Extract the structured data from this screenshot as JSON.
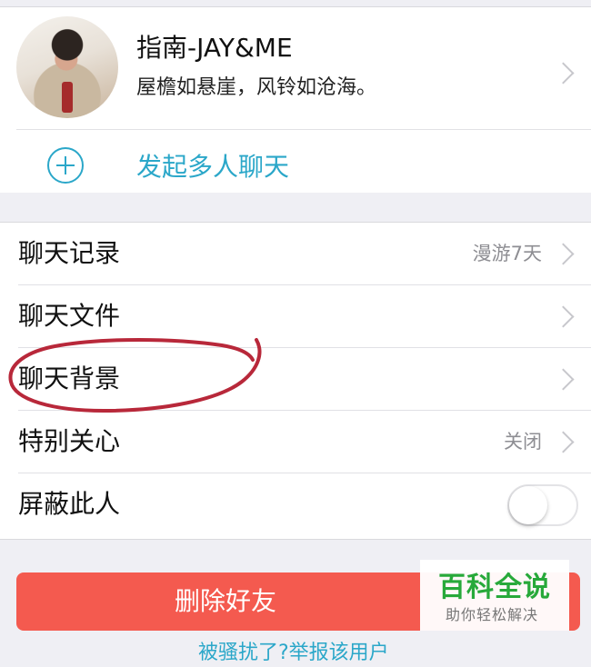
{
  "profile": {
    "name": "指南-JAY&ME",
    "motto": "屋檐如悬崖，风铃如沧海。"
  },
  "group_chat": {
    "label": "发起多人聊天"
  },
  "settings": {
    "rows": [
      {
        "label": "聊天记录",
        "value": "漫游7天"
      },
      {
        "label": "聊天文件",
        "value": ""
      },
      {
        "label": "聊天背景",
        "value": ""
      },
      {
        "label": "特别关心",
        "value": "关闭"
      },
      {
        "label": "屏蔽此人",
        "toggle_on": false
      }
    ]
  },
  "actions": {
    "delete_label": "删除好友",
    "report_label": "被骚扰了?举报该用户"
  },
  "watermark": {
    "title": "百科全说",
    "subtitle": "助你轻松解决"
  },
  "colors": {
    "accent": "#2ba7c9",
    "danger": "#f45a4f",
    "annotation": "#b8283a",
    "watermark_green": "#27a93a"
  }
}
